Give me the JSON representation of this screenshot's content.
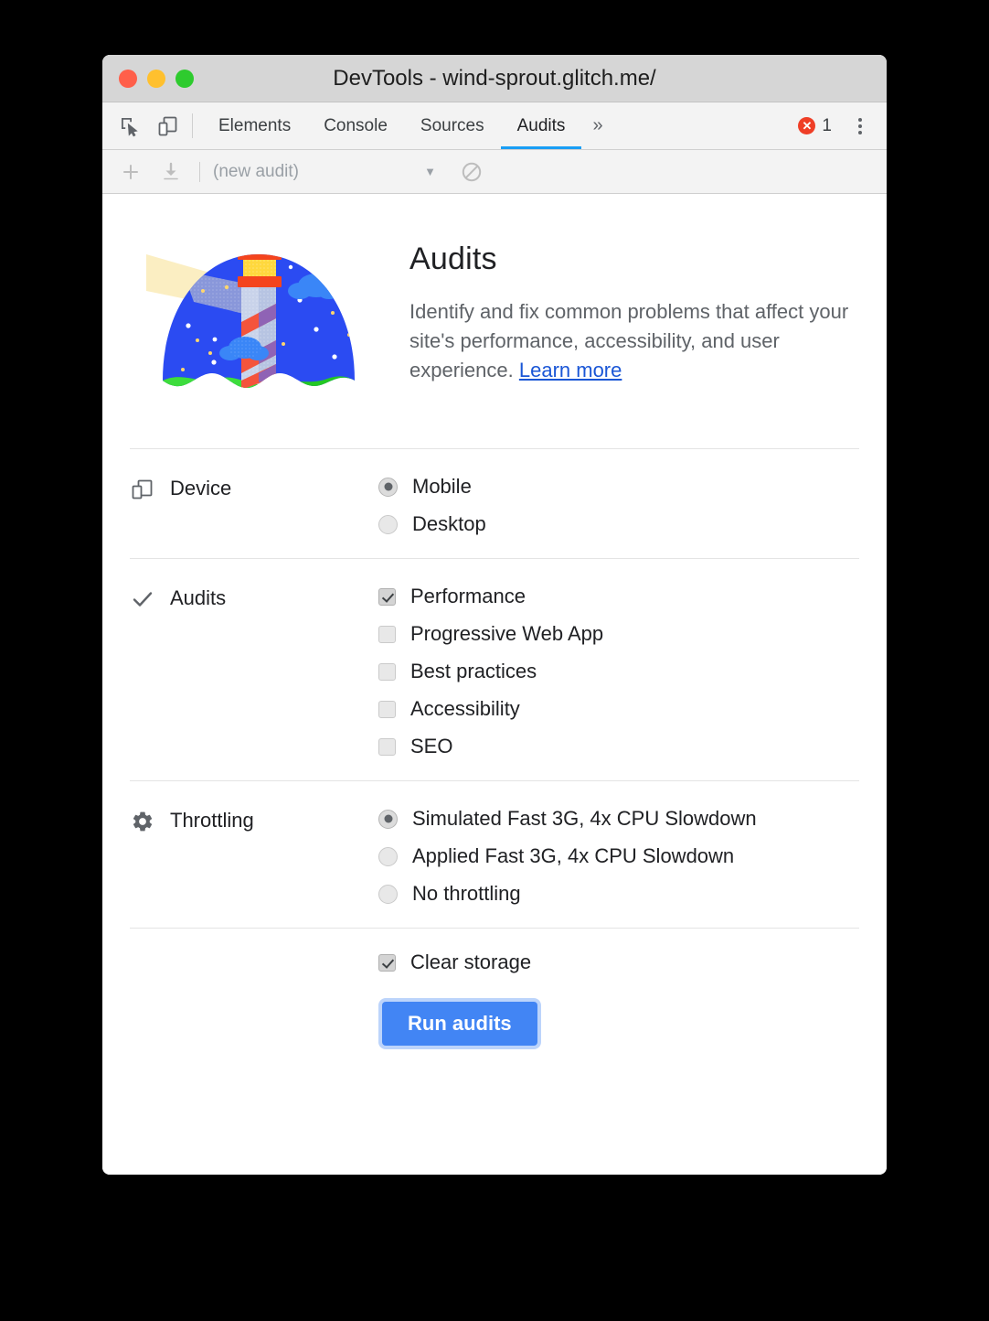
{
  "window": {
    "title": "DevTools - wind-sprout.glitch.me/",
    "traffic_lights": [
      "close",
      "minimize",
      "zoom"
    ]
  },
  "tabbar": {
    "inspect_icon": "inspect-cursor-icon",
    "device_toggle_icon": "device-toggle-icon",
    "tabs": [
      {
        "label": "Elements",
        "active": false
      },
      {
        "label": "Console",
        "active": false
      },
      {
        "label": "Sources",
        "active": false
      },
      {
        "label": "Audits",
        "active": true
      }
    ],
    "more_tabs": "»",
    "error_count": "1",
    "error_icon": "error-circle-icon",
    "menu_icon": "kebab-menu-icon",
    "active_tab_underline_color": "#1a9ef5"
  },
  "actionbar": {
    "add_icon": "plus-icon",
    "download_icon": "download-icon",
    "select_value": "(new audit)",
    "caret": "▼",
    "clear_icon": "no-entry-icon"
  },
  "hero": {
    "artwork": "lighthouse-illustration",
    "title": "Audits",
    "description": "Identify and fix common problems that affect your site's performance, accessibility, and user experience. ",
    "link_label": "Learn more",
    "link_color": "#1a56d6"
  },
  "sections": [
    {
      "id": "device",
      "icon": "device-icon",
      "label": "Device",
      "control": "radio",
      "options": [
        {
          "label": "Mobile",
          "checked": true
        },
        {
          "label": "Desktop",
          "checked": false
        }
      ]
    },
    {
      "id": "audits",
      "icon": "checkmark-icon",
      "label": "Audits",
      "control": "checkbox",
      "options": [
        {
          "label": "Performance",
          "checked": true
        },
        {
          "label": "Progressive Web App",
          "checked": false
        },
        {
          "label": "Best practices",
          "checked": false
        },
        {
          "label": "Accessibility",
          "checked": false
        },
        {
          "label": "SEO",
          "checked": false
        }
      ]
    },
    {
      "id": "throttling",
      "icon": "gear-icon",
      "label": "Throttling",
      "control": "radio",
      "options": [
        {
          "label": "Simulated Fast 3G, 4x CPU Slowdown",
          "checked": true
        },
        {
          "label": "Applied Fast 3G, 4x CPU Slowdown",
          "checked": false
        },
        {
          "label": "No throttling",
          "checked": false
        }
      ]
    }
  ],
  "footer": {
    "clear_storage": {
      "label": "Clear storage",
      "checked": true
    },
    "run_button": "Run audits",
    "run_button_color": "#4285f4"
  }
}
